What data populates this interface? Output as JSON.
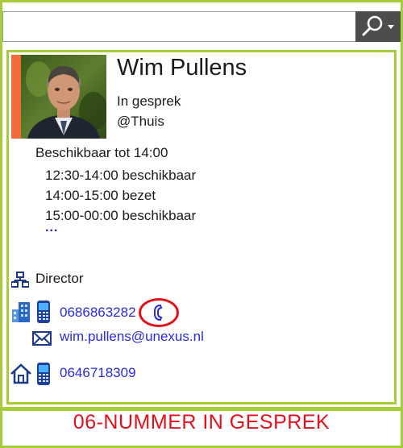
{
  "search": {
    "value": "",
    "placeholder": ""
  },
  "contact": {
    "name": "Wim Pullens",
    "presence": "In gesprek",
    "location": "@Thuis",
    "presence_color": "#f26b3a",
    "availability": {
      "heading": "Beschikbaar tot 14:00",
      "slots": [
        "12:30-14:00 beschikbaar",
        "14:00-15:00 bezet",
        "15:00-00:00 beschikbaar"
      ],
      "more": "..."
    },
    "title": "Director",
    "work_mobile": "0686863282",
    "email": "wim.pullens@unexus.nl",
    "home_mobile": "0646718309"
  },
  "icons": {
    "search": "search-icon",
    "dropdown": "dropdown-arrow-icon",
    "org": "org-chart-icon",
    "building": "building-icon",
    "mobile": "mobile-phone-icon",
    "call": "in-call-icon",
    "mail": "mail-icon",
    "home": "home-icon"
  },
  "caption": "06-NUMMER IN GESPREK",
  "colors": {
    "frame": "#a6cc3a",
    "link": "#2a2adf",
    "highlight": "#e3101c",
    "search_button": "#4d4d4d"
  }
}
